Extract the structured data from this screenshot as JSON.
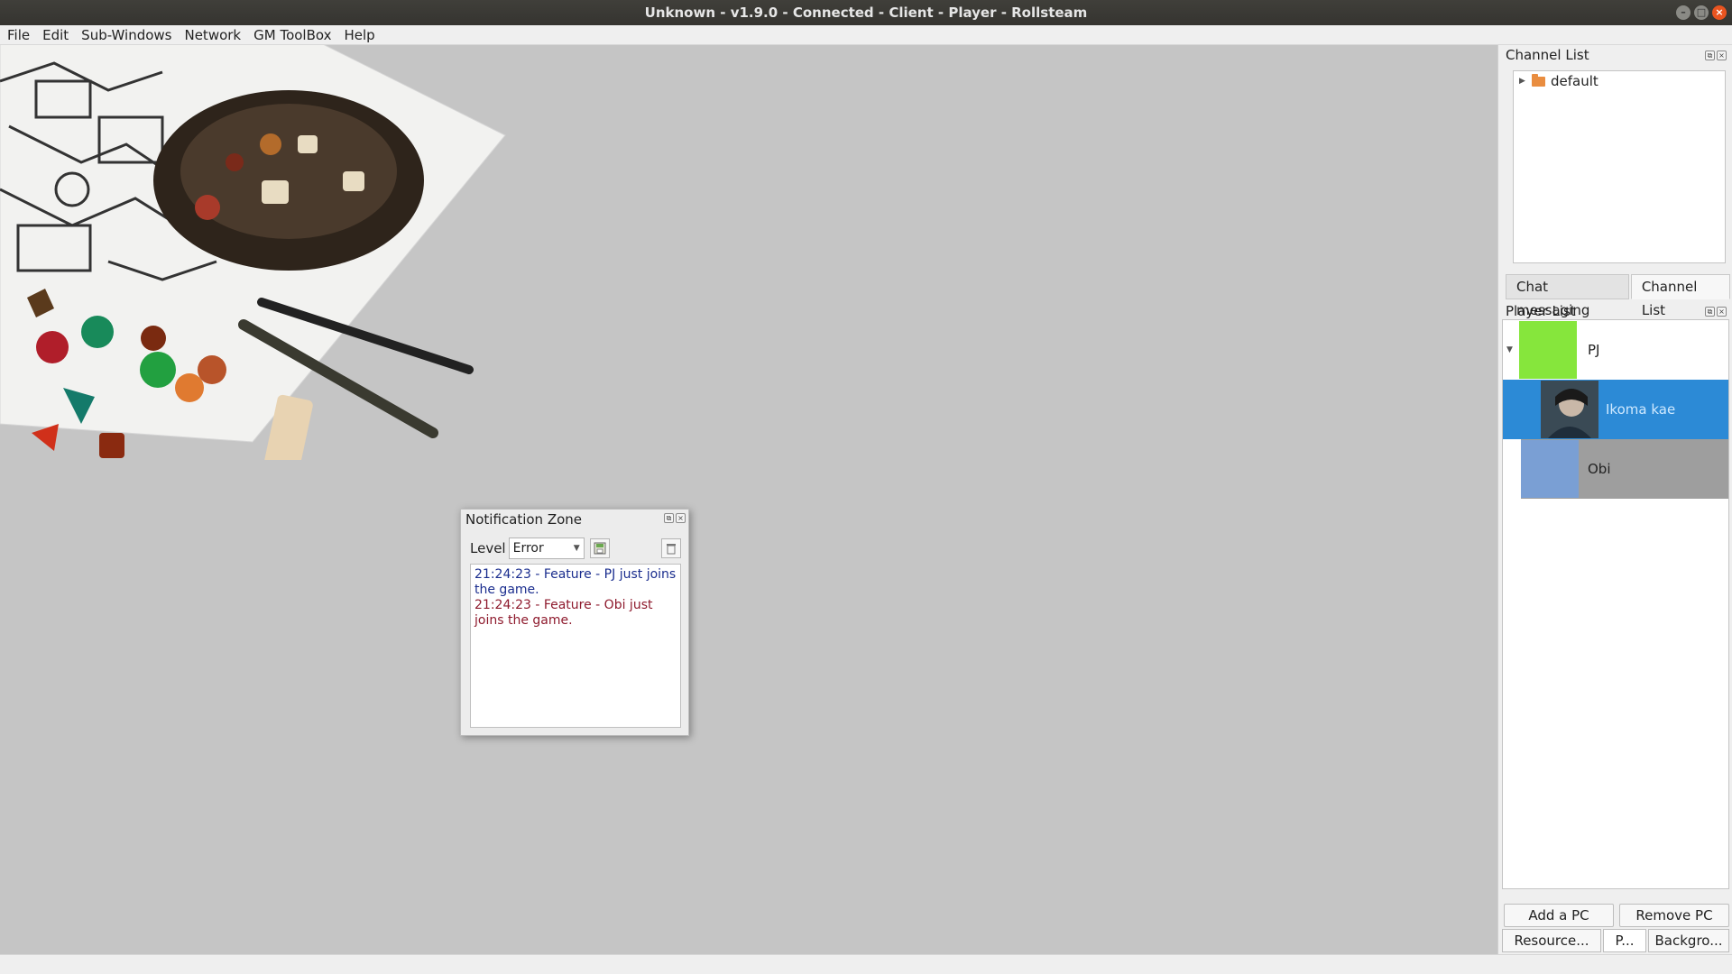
{
  "window": {
    "title": "Unknown - v1.9.0 - Connected - Client - Player - Rollsteam",
    "controls": [
      "minimize-icon",
      "maximize-icon",
      "close-icon"
    ]
  },
  "menubar": {
    "items": [
      "File",
      "Edit",
      "Sub-Windows",
      "Network",
      "GM ToolBox",
      "Help"
    ]
  },
  "notification_zone": {
    "title": "Notification Zone",
    "level_label": "Level",
    "level_value": "Error",
    "entries": [
      {
        "text": "21:24:23 - Feature - PJ just joins the game.",
        "color": "#1a2d8e"
      },
      {
        "text": "21:24:23 - Feature - Obi just joins the game.",
        "color": "#8e1a2d"
      }
    ]
  },
  "channel_list": {
    "title": "Channel List",
    "items": [
      {
        "label": "default",
        "icon": "folder-icon"
      }
    ]
  },
  "tabs": {
    "items": [
      "Chat messaging",
      "Channel List"
    ],
    "active": "Channel List"
  },
  "player_list": {
    "title": "Player List",
    "players": [
      {
        "label": "PJ",
        "color": "#86e63c",
        "selected": false,
        "expanded": true
      },
      {
        "label": "Ikoma kae",
        "color": "#2c8ad6",
        "selected": true,
        "avatar": "character-portrait"
      },
      {
        "label": "Obi",
        "color": "#7a9fd4",
        "selected": false
      }
    ]
  },
  "buttons": {
    "add_pc": "Add a PC",
    "remove_pc": "Remove PC"
  },
  "bottom_tabs": {
    "items": [
      "Resource...",
      "P...",
      "Backgro..."
    ]
  },
  "colors": {
    "accent": "#e95420",
    "selection": "#2c8ad6",
    "workspace": "#c5c5c5"
  }
}
